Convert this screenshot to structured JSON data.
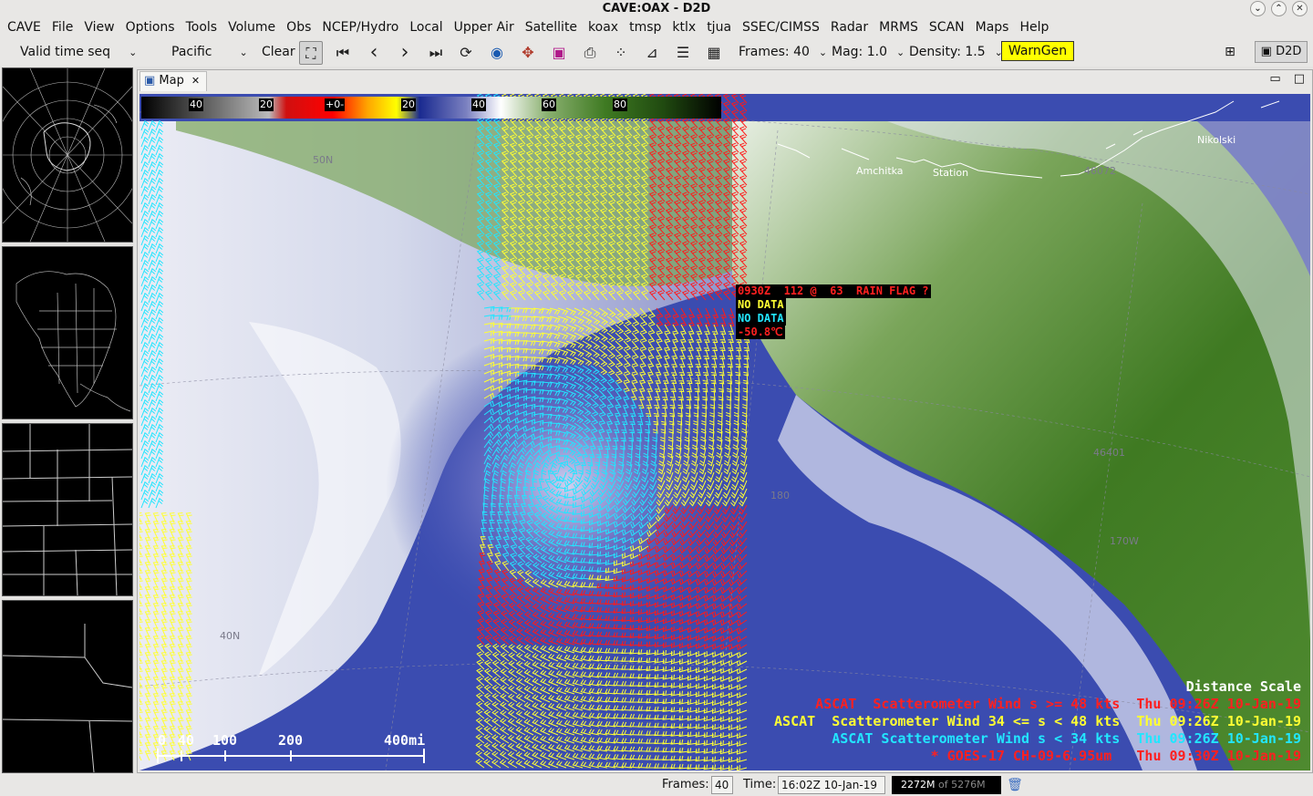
{
  "window": {
    "title": "CAVE:OAX - D2D",
    "controls": [
      "⌄",
      "⌃",
      "✕"
    ]
  },
  "menu": {
    "items": [
      "CAVE",
      "File",
      "View",
      "Options",
      "Tools",
      "Volume",
      "Obs",
      "NCEP/Hydro",
      "Local",
      "Upper Air",
      "Satellite",
      "koax",
      "tmsp",
      "ktlx",
      "tjua",
      "SSEC/CIMSS",
      "Radar",
      "MRMS",
      "SCAN",
      "Maps",
      "Help"
    ]
  },
  "toolbar": {
    "loop_mode": "Valid time seq",
    "scale": "Pacific",
    "clear_label": "Clear",
    "frames_label": "Frames: 40",
    "mag_label": "Mag: 1.0",
    "density_label": "Density: 1.5",
    "warngen_label": "WarnGen",
    "perspective_label": "D2D",
    "icons": {
      "zoom": "⛶",
      "first": "⏮",
      "prev": "‹",
      "next": "›",
      "last": "⏭",
      "loop": "⟳",
      "sat": "◉",
      "pan": "✥",
      "img": "▣",
      "print": "⎙",
      "points": "⁘",
      "baselines": "⊿",
      "list": "☰",
      "layout": "▦"
    }
  },
  "map": {
    "tab_label": "Map",
    "colorbar_labels": [
      "40",
      "20",
      "+0-",
      "20",
      "40",
      "60",
      "80"
    ],
    "colors": {
      "red": "#ff1a1a",
      "yellow": "#ffff33",
      "cyan": "#22e6ff",
      "green": "#3f7a22",
      "blue": "#3b4cb0"
    },
    "sample": {
      "line1": "0930Z  112 @  63  RAIN FLAG ?",
      "line2": "NO DATA",
      "line3": "NO DATA",
      "line4": "-50.8℃"
    },
    "places": [
      "Amchitka",
      "Station",
      "Nikolski"
    ],
    "grid_labels": [
      "50N",
      "40N",
      "180",
      "170W"
    ],
    "station_ids": [
      "46072",
      "46401"
    ],
    "legend": {
      "title": "Distance Scale",
      "red_line": "ASCAT  Scatterometer Wind s >= 48 kts  Thu 09:26Z 10-Jan-19",
      "yellow_line": "ASCAT  Scatterometer Wind 34 <= s < 48 kts  Thu 09:26Z 10-Jan-19",
      "cyan_line": "ASCAT Scatterometer Wind s < 34 kts  Thu 09:26Z 10-Jan-19",
      "goes_line": "* GOES-17 CH-09-6.95um   Thu 09:30Z 10-Jan-19"
    },
    "scale_labels": [
      "0",
      "40",
      "100",
      "200",
      "400mi"
    ]
  },
  "status": {
    "frames_label": "Frames:",
    "frames_value": "40",
    "time_label": "Time:",
    "time_value": "16:02Z 10-Jan-19",
    "memory_used": "2272M",
    "memory_total": "of 5276M"
  }
}
